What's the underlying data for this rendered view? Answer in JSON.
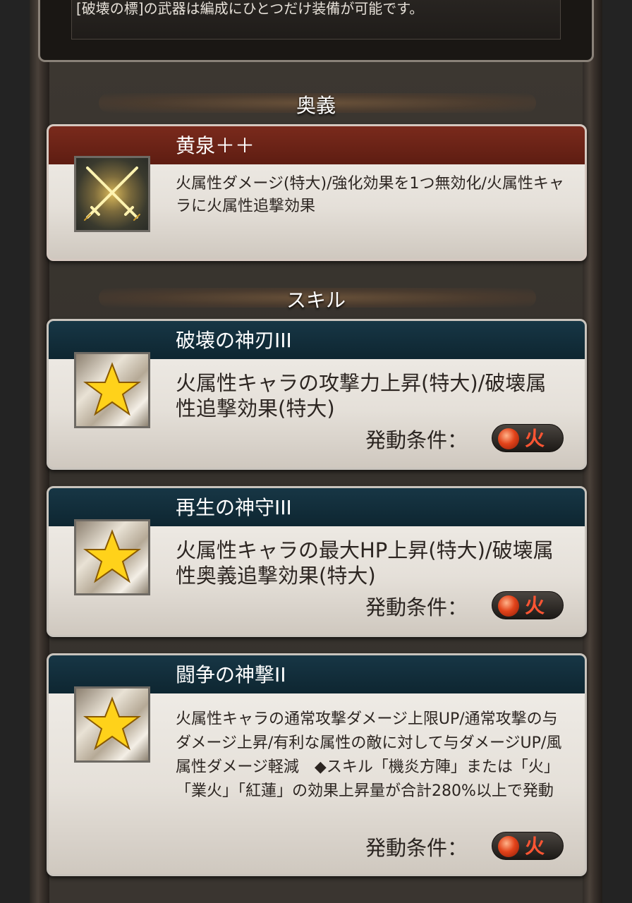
{
  "header_note": "[破壊の標]の武器は編成にひとつだけ装備が可能です。",
  "sections": {
    "ougi_title": "奥義",
    "skill_title": "スキル"
  },
  "ougi": {
    "name": "黄泉＋＋",
    "description": "火属性ダメージ(特大)/強化効果を1つ無効化/火属性キャラに火属性追撃効果",
    "icon": "crossed-swords-icon"
  },
  "skills": [
    {
      "name": "破壊の神刃III",
      "description": "火属性キャラの攻撃力上昇(特大)/破壊属性追撃効果(特大)",
      "condition_label": "発動条件：",
      "element": "火",
      "icon": "star-icon"
    },
    {
      "name": "再生の神守III",
      "description": "火属性キャラの最大HP上昇(特大)/破壊属性奥義追撃効果(特大)",
      "condition_label": "発動条件：",
      "element": "火",
      "icon": "star-icon"
    },
    {
      "name": "闘争の神撃II",
      "description": "火属性キャラの通常攻撃ダメージ上限UP/通常攻撃の与ダメージ上昇/有利な属性の敵に対して与ダメージUP/風属性ダメージ軽減　◆スキル「機炎方陣」または「火」「業火」「紅蓮」の効果上昇量が合計280%以上で発動",
      "condition_label": "発動条件：",
      "element": "火",
      "icon": "star-icon"
    }
  ],
  "colors": {
    "ougi_bar": "#6b2317",
    "skill_bar": "#12303d",
    "fire": "#e2431a"
  }
}
